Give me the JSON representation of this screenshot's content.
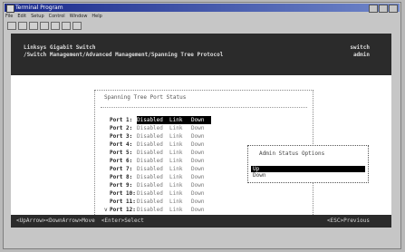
{
  "window": {
    "title": "Terminal Program",
    "menu": [
      "File",
      "Edit",
      "Setup",
      "Control",
      "Window",
      "Help"
    ],
    "toolbar_icons": [
      "new-icon",
      "open-icon",
      "save-icon",
      "cut-icon",
      "copy-icon",
      "paste-icon",
      "print-icon"
    ]
  },
  "header": {
    "line1": "Linksys Gigabit Switch",
    "line2": "/Switch Management/Advanced Management/Spanning Tree Protocol",
    "right1": "switch",
    "right2": "admin"
  },
  "panel": {
    "title": "Spanning Tree Port Status",
    "rows": [
      {
        "port": "Port 1:",
        "state": "Disabled",
        "link": "Link",
        "speed": "Down"
      },
      {
        "port": "Port 2:",
        "state": "Disabled",
        "link": "Link",
        "speed": "Down"
      },
      {
        "port": "Port 3:",
        "state": "Disabled",
        "link": "Link",
        "speed": "Down"
      },
      {
        "port": "Port 4:",
        "state": "Disabled",
        "link": "Link",
        "speed": "Down"
      },
      {
        "port": "Port 5:",
        "state": "Disabled",
        "link": "Link",
        "speed": "Down"
      },
      {
        "port": "Port 6:",
        "state": "Disabled",
        "link": "Link",
        "speed": "Down"
      },
      {
        "port": "Port 7:",
        "state": "Disabled",
        "link": "Link",
        "speed": "Down"
      },
      {
        "port": "Port 8:",
        "state": "Disabled",
        "link": "Link",
        "speed": "Down"
      },
      {
        "port": "Port 9:",
        "state": "Disabled",
        "link": "Link",
        "speed": "Down"
      },
      {
        "port": "Port 10:",
        "state": "Disabled",
        "link": "Link",
        "speed": "Down"
      },
      {
        "port": "Port 11:",
        "state": "Disabled",
        "link": "Link",
        "speed": "Down"
      },
      {
        "port": "Port 12:",
        "state": "Disabled",
        "link": "Link",
        "speed": "Down"
      }
    ],
    "selected_index": 0,
    "more_marker": "v"
  },
  "popup": {
    "title": "Admin Status Options",
    "options": [
      "Up",
      "Down"
    ],
    "selected_index": 0
  },
  "status": {
    "left": "<UpArrow><DownArrow>Move  <Enter>Select",
    "right": "<ESC>Previous"
  }
}
